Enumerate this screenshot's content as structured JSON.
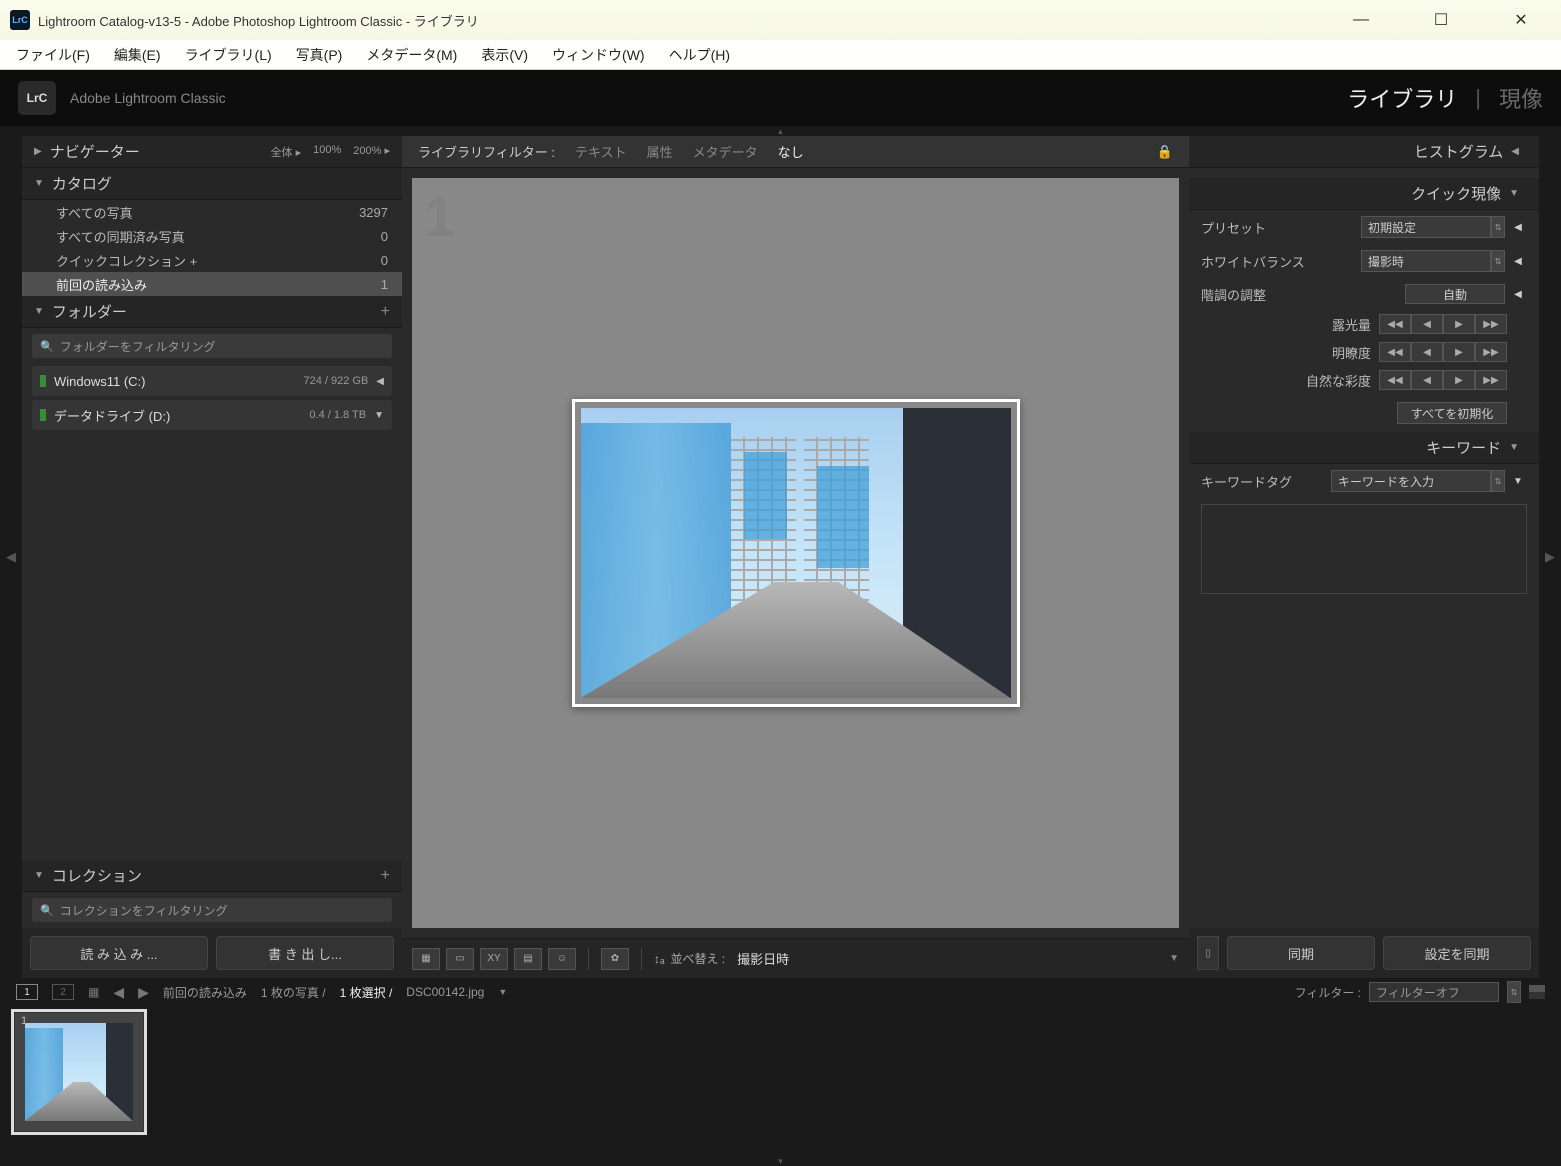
{
  "titlebar": {
    "title": "Lightroom Catalog-v13-5 - Adobe Photoshop Lightroom Classic - ライブラリ",
    "icon": "LrC"
  },
  "menubar": {
    "items": [
      "ファイル(F)",
      "編集(E)",
      "ライブラリ(L)",
      "写真(P)",
      "メタデータ(M)",
      "表示(V)",
      "ウィンドウ(W)",
      "ヘルプ(H)"
    ]
  },
  "header": {
    "badge": "LrC",
    "app_name": "Adobe Lightroom Classic",
    "module_library": "ライブラリ",
    "module_develop": "現像"
  },
  "left": {
    "navigator": {
      "title": "ナビゲーター",
      "zoom_fit": "全体",
      "zoom_100": "100%",
      "zoom_200": "200%"
    },
    "catalog": {
      "title": "カタログ",
      "rows": [
        {
          "label": "すべての写真",
          "count": "3297"
        },
        {
          "label": "すべての同期済み写真",
          "count": "0"
        },
        {
          "label": "クイックコレクション +",
          "count": "0"
        },
        {
          "label": "前回の読み込み",
          "count": "1"
        }
      ]
    },
    "folders": {
      "title": "フォルダー",
      "filter_placeholder": "フォルダーをフィルタリング",
      "volumes": [
        {
          "name": "Windows11 (C:)",
          "size": "724 / 922 GB"
        },
        {
          "name": "データドライブ (D:)",
          "size": "0.4 / 1.8 TB"
        }
      ]
    },
    "collections": {
      "title": "コレクション",
      "filter_placeholder": "コレクションをフィルタリング"
    },
    "buttons": {
      "import": "読 み 込 み ...",
      "export": "書 き 出 し..."
    }
  },
  "center": {
    "filter_bar": {
      "label": "ライブラリフィルター :",
      "text": "テキスト",
      "attribute": "属性",
      "metadata": "メタデータ",
      "none": "なし"
    },
    "cell_number": "1",
    "toolbar": {
      "sort_label": "並べ替え :",
      "sort_value": "撮影日時"
    }
  },
  "right": {
    "histogram": {
      "title": "ヒストグラム"
    },
    "quick_develop": {
      "title": "クイック現像",
      "preset_label": "プリセット",
      "preset_value": "初期設定",
      "wb_label": "ホワイトバランス",
      "wb_value": "撮影時",
      "tone_label": "階調の調整",
      "tone_auto": "自動",
      "exposure": "露光量",
      "clarity": "明瞭度",
      "vibrance": "自然な彩度",
      "reset": "すべてを初期化"
    },
    "keywords": {
      "title": "キーワード",
      "tag_label": "キーワードタグ",
      "input_value": "キーワードを入力"
    },
    "buttons": {
      "sync": "同期",
      "sync_settings": "設定を同期"
    }
  },
  "statusbar": {
    "monitor1": "1",
    "monitor2": "2",
    "source": "前回の読み込み",
    "count": "1 枚の写真 /",
    "selected": "1 枚選択 /",
    "filename": "DSC00142.jpg",
    "filter_label": "フィルター :",
    "filter_value": "フィルターオフ"
  },
  "filmstrip": {
    "thumb_num": "1"
  }
}
